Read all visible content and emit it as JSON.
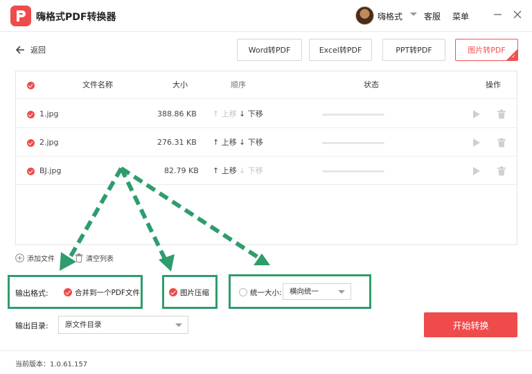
{
  "app": {
    "title": "嗨格式PDF转换器",
    "username": "嗨格式",
    "links": [
      "客服",
      "菜单"
    ]
  },
  "nav": {
    "back_label": "返回",
    "tabs": [
      {
        "label": "Word转PDF",
        "active": false
      },
      {
        "label": "Excel转PDF",
        "active": false
      },
      {
        "label": "PPT转PDF",
        "active": false
      },
      {
        "label": "图片转PDF",
        "active": true
      }
    ]
  },
  "table": {
    "headers": {
      "name": "文件名称",
      "size": "大小",
      "order": "顺序",
      "status": "状态",
      "action": "操作"
    },
    "rows": [
      {
        "name": "1.jpg",
        "size": "388.86 KB",
        "up": "上移",
        "down": "下移",
        "up_enabled": false,
        "down_enabled": true
      },
      {
        "name": "2.jpg",
        "size": "276.31 KB",
        "up": "上移",
        "down": "下移",
        "up_enabled": true,
        "down_enabled": true
      },
      {
        "name": "BJ.jpg",
        "size": "82.79 KB",
        "up": "上移",
        "down": "下移",
        "up_enabled": true,
        "down_enabled": false
      }
    ]
  },
  "list_actions": {
    "add_file": "添加文件",
    "clear_list": "清空列表"
  },
  "options": {
    "output_format_label": "输出格式:",
    "merge_label": "合并到一个PDF文件",
    "compress_label": "图片压缩",
    "unify_size_label": "统一大小:",
    "unify_size_value": "横向统一",
    "output_dir_label": "输出目录:",
    "output_dir_value": "原文件目录"
  },
  "start_button": "开始转换",
  "version": "当前版本：1.0.61.157",
  "colors": {
    "accent": "#ef4b4b",
    "annotation": "#2e9c6c"
  }
}
